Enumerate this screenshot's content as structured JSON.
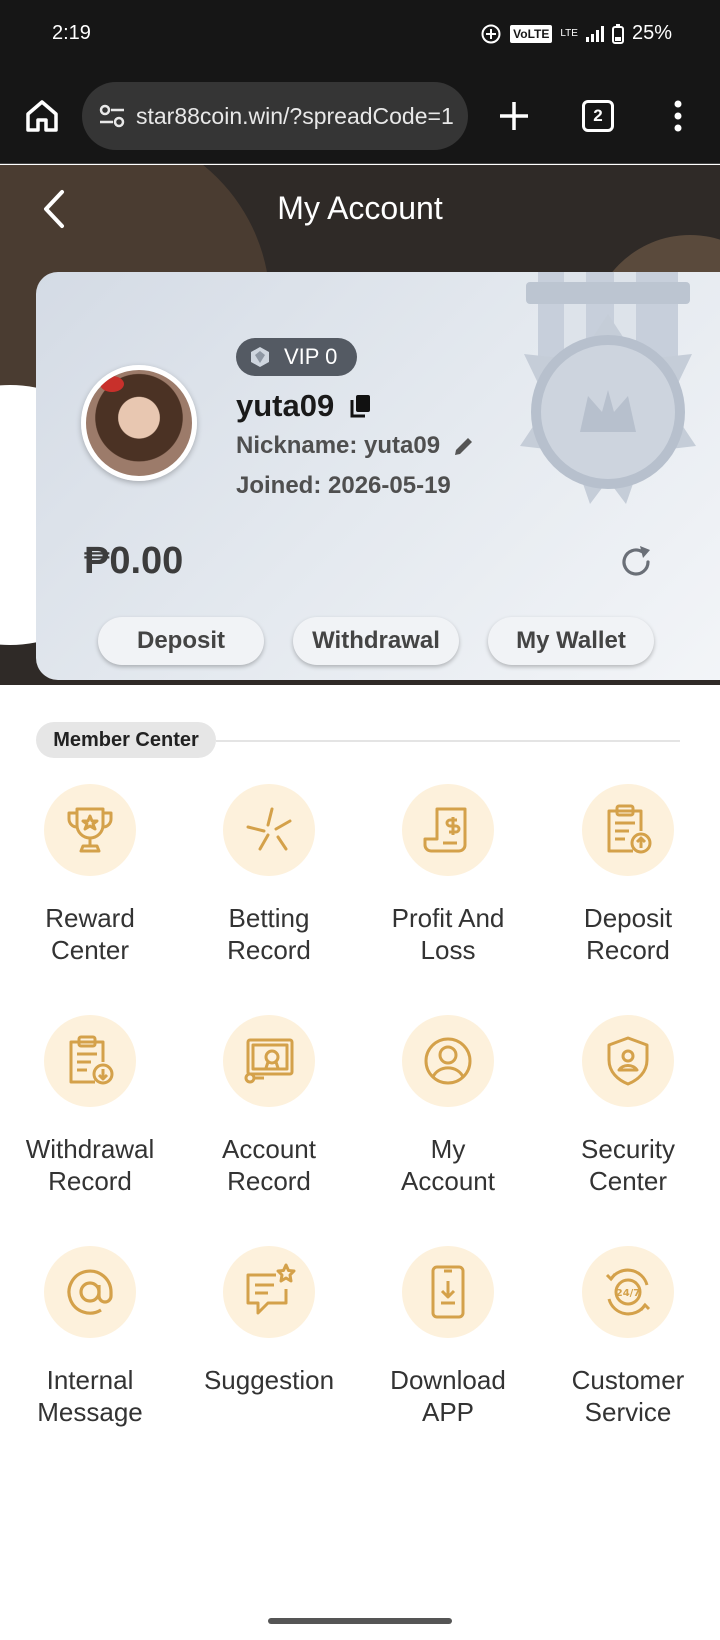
{
  "status_bar": {
    "time": "2:19",
    "volte": "VoLTE",
    "lte": "LTE",
    "battery": "25%"
  },
  "browser": {
    "url": "star88coin.win/?spreadCode=1",
    "tab_count": "2"
  },
  "header": {
    "title": "My Account"
  },
  "profile": {
    "vip": "VIP 0",
    "username": "yuta09",
    "nickname": "Nickname: yuta09",
    "joined": "Joined: 2026-05-19",
    "balance": "₱0.00"
  },
  "actions": {
    "deposit": "Deposit",
    "withdrawal": "Withdrawal",
    "wallet": "My Wallet"
  },
  "member_center": {
    "title": "Member Center",
    "items": [
      {
        "line1": "Reward",
        "line2": "Center",
        "icon": "trophy-icon"
      },
      {
        "line1": "Betting",
        "line2": "Record",
        "icon": "sparkle-icon"
      },
      {
        "line1": "Profit And",
        "line2": "Loss",
        "icon": "receipt-dollar-icon"
      },
      {
        "line1": "Deposit",
        "line2": "Record",
        "icon": "clipboard-upload-icon"
      },
      {
        "line1": "Withdrawal",
        "line2": "Record",
        "icon": "clipboard-download-icon"
      },
      {
        "line1": "Account",
        "line2": "Record",
        "icon": "certificate-icon"
      },
      {
        "line1": "My",
        "line2": "Account",
        "icon": "user-circle-icon"
      },
      {
        "line1": "Security",
        "line2": "Center",
        "icon": "shield-user-icon"
      },
      {
        "line1": "Internal",
        "line2": "Message",
        "icon": "at-sign-icon"
      },
      {
        "line1": "Suggestion",
        "line2": "",
        "icon": "chat-star-icon"
      },
      {
        "line1": "Download",
        "line2": "APP",
        "icon": "phone-download-icon"
      },
      {
        "line1": "Customer",
        "line2": "Service",
        "icon": "support-24-7-icon"
      }
    ]
  },
  "colors": {
    "accent": "#d4a14a",
    "icon_bg": "#fdf1dc",
    "header_bg": "#2f2a27"
  }
}
